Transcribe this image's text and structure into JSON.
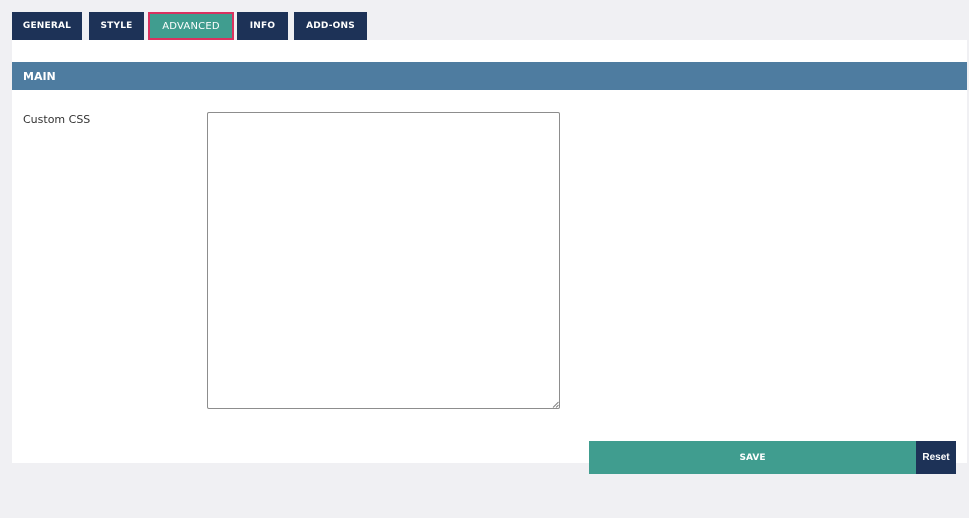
{
  "tabs": [
    {
      "label": "GENERAL",
      "active": false
    },
    {
      "label": "STYLE",
      "active": false
    },
    {
      "label": "ADVANCED",
      "active": true
    },
    {
      "label": "INFO",
      "active": false
    },
    {
      "label": "ADD-ONS",
      "active": false
    }
  ],
  "section": {
    "title": "MAIN"
  },
  "fields": {
    "custom_css": {
      "label": "Custom CSS",
      "value": "",
      "placeholder": ""
    }
  },
  "actions": {
    "save_label": "SAVE",
    "reset_label": "Reset"
  },
  "colors": {
    "tab_background": "#1d3257",
    "tab_active_background": "#409d8f",
    "tab_active_border": "#d9325f",
    "section_header": "#4e7ca0",
    "save_button": "#409d8f",
    "reset_button": "#1d3257",
    "page_background": "#f0f0f3"
  }
}
